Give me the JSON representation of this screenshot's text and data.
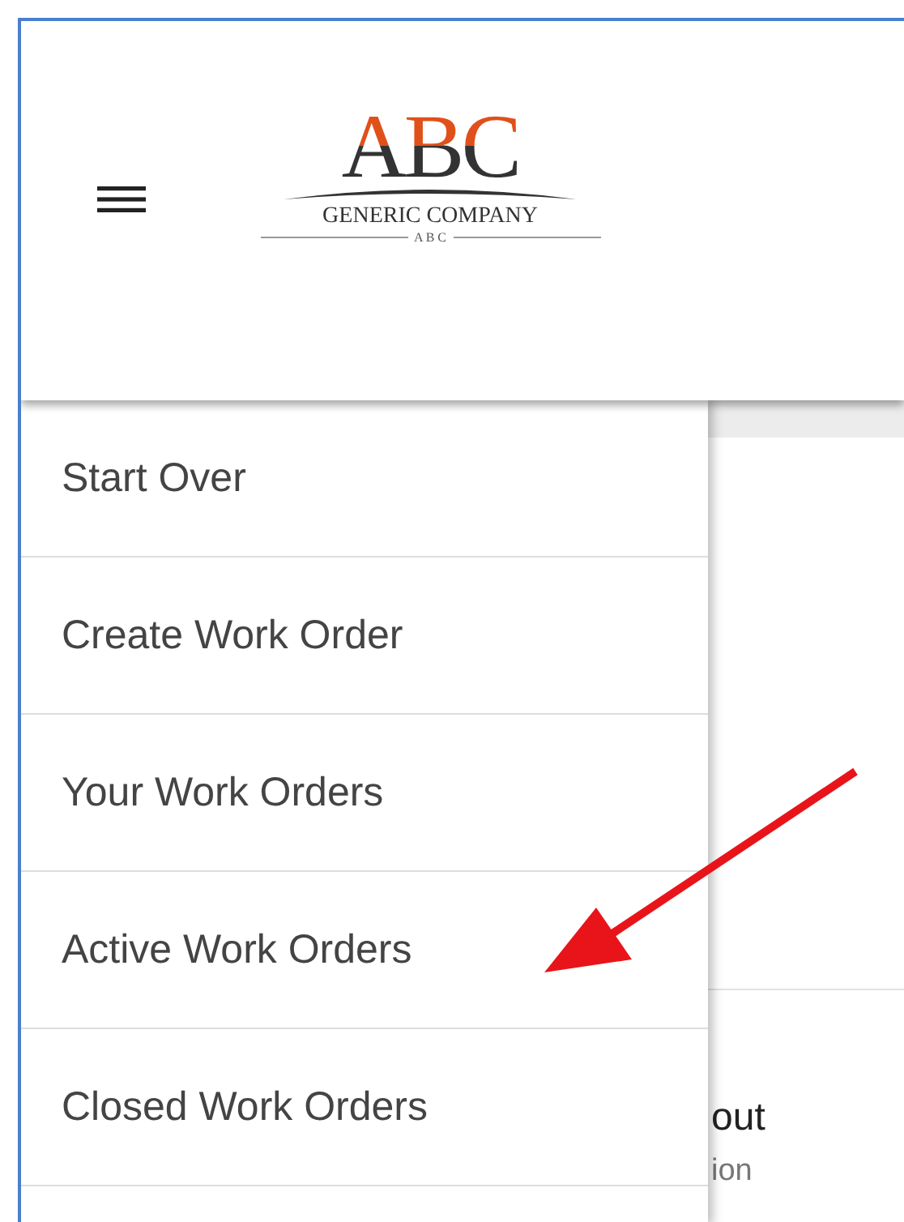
{
  "header": {
    "logo": {
      "title": "ABC",
      "subtitle": "GENERIC COMPANY",
      "tagline": "A B C"
    }
  },
  "menu": {
    "items": [
      {
        "label": "Start Over"
      },
      {
        "label": "Create Work Order"
      },
      {
        "label": "Your Work Orders"
      },
      {
        "label": "Active Work Orders"
      },
      {
        "label": "Closed Work Orders"
      }
    ]
  },
  "background_page": {
    "title": "out",
    "subtitle": "ion"
  }
}
